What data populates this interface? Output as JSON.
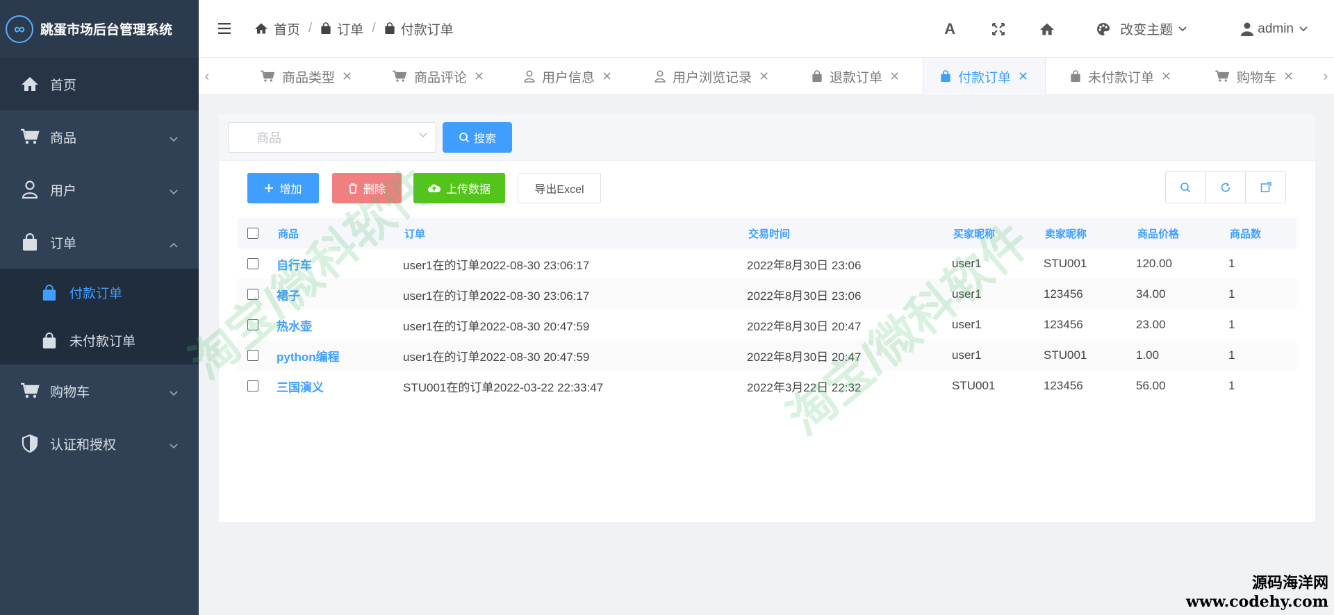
{
  "app": {
    "title": "跳蛋市场后台管理系统",
    "logo_glyph": "∞"
  },
  "sidebar": {
    "items": [
      {
        "label": "首页",
        "icon": "home-icon"
      },
      {
        "label": "商品",
        "icon": "cart-icon"
      },
      {
        "label": "用户",
        "icon": "user-icon"
      },
      {
        "label": "订单",
        "icon": "bag-icon"
      },
      {
        "label": "购物车",
        "icon": "cart-icon"
      },
      {
        "label": "认证和授权",
        "icon": "shield-icon"
      }
    ],
    "order_submenu": [
      {
        "label": "付款订单",
        "icon": "bag-icon",
        "active": true
      },
      {
        "label": "未付款订单",
        "icon": "bag-icon",
        "active": false
      }
    ]
  },
  "header": {
    "breadcrumb": [
      "首页",
      "订单",
      "付款订单"
    ],
    "font_label": "A",
    "theme_label": "改变主题",
    "user_label": "admin"
  },
  "tabs": [
    {
      "label": "商品类型",
      "icon": "cart-icon"
    },
    {
      "label": "商品评论",
      "icon": "cart-icon"
    },
    {
      "label": "用户信息",
      "icon": "user-icon"
    },
    {
      "label": "用户浏览记录",
      "icon": "user-icon"
    },
    {
      "label": "退款订单",
      "icon": "bag-icon"
    },
    {
      "label": "付款订单",
      "icon": "bag-icon",
      "active": true
    },
    {
      "label": "未付款订单",
      "icon": "bag-icon"
    },
    {
      "label": "购物车",
      "icon": "cart-icon"
    }
  ],
  "search": {
    "placeholder": "商品",
    "button_label": "搜索"
  },
  "toolbar": {
    "add_label": "增加",
    "delete_label": "删除",
    "upload_label": "上传数据",
    "export_label": "导出Excel"
  },
  "table": {
    "columns": [
      "商品",
      "订单",
      "交易时间",
      "买家昵称",
      "卖家昵称",
      "商品价格",
      "商品数"
    ],
    "rows": [
      {
        "product": "自行车",
        "order": "user1在的订单2022-08-30 23:06:17",
        "time": "2022年8月30日 23:06",
        "buyer": "user1",
        "seller": "STU001",
        "price": "120.00",
        "qty": "1"
      },
      {
        "product": "裙子",
        "order": "user1在的订单2022-08-30 23:06:17",
        "time": "2022年8月30日 23:06",
        "buyer": "user1",
        "seller": "123456",
        "price": "34.00",
        "qty": "1"
      },
      {
        "product": "热水壶",
        "order": "user1在的订单2022-08-30 20:47:59",
        "time": "2022年8月30日 20:47",
        "buyer": "user1",
        "seller": "123456",
        "price": "23.00",
        "qty": "1"
      },
      {
        "product": "python编程",
        "order": "user1在的订单2022-08-30 20:47:59",
        "time": "2022年8月30日 20:47",
        "buyer": "user1",
        "seller": "STU001",
        "price": "1.00",
        "qty": "1"
      },
      {
        "product": "三国演义",
        "order": "STU001在的订单2022-03-22 22:33:47",
        "time": "2022年3月22日 22:32",
        "buyer": "STU001",
        "seller": "123456",
        "price": "56.00",
        "qty": "1"
      }
    ]
  },
  "watermark": {
    "text": "淘宝/微科软件"
  },
  "corner_badge": {
    "line1": "源码海洋网",
    "line2": "www.codehy.com"
  },
  "colors": {
    "sidebar": "#304156",
    "accent": "#409eff",
    "danger": "#f08080",
    "success": "#52c41a"
  }
}
